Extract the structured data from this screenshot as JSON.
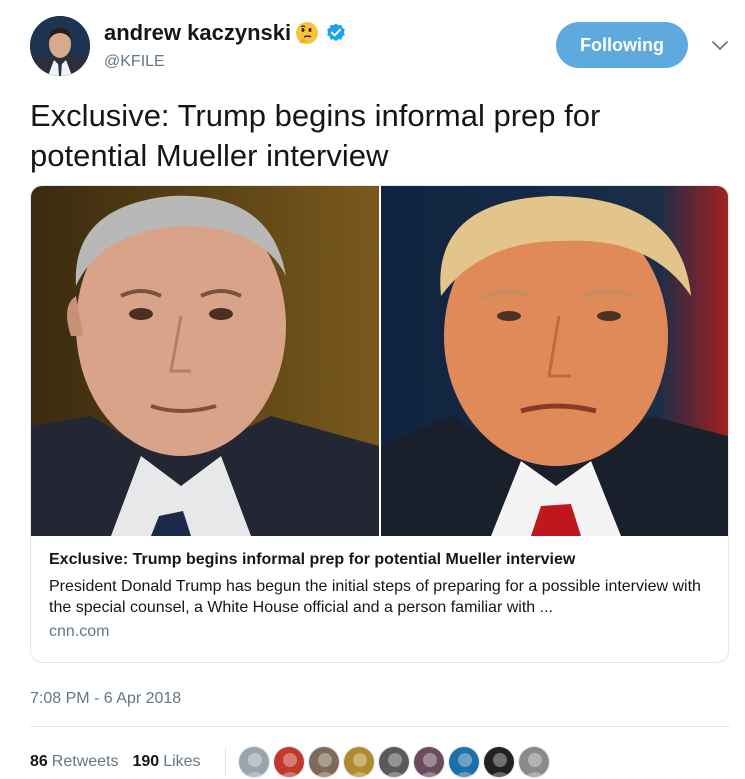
{
  "author": {
    "display_name": "andrew kaczynski",
    "handle": "@KFILE",
    "avatar_icon": "profile-photo",
    "name_emoji": "thinking-face-icon",
    "verified_icon": "verified-badge-icon"
  },
  "follow_button": {
    "label": "Following",
    "color": "#5ea9dd"
  },
  "menu_icon": "chevron-down-icon",
  "tweet": {
    "text": "Exclusive: Trump begins informal prep for potential Mueller interview",
    "timestamp": "7:08 PM - 6 Apr 2018"
  },
  "card": {
    "image": "split-photo-two-men",
    "title": "Exclusive: Trump begins informal prep for potential Mueller interview",
    "description": "President Donald Trump has begun the initial steps of preparing for a possible interview with the special counsel, a White House official and a person familiar with ...",
    "domain": "cnn.com"
  },
  "stats": {
    "retweets_count": "86",
    "retweets_label": "Retweets",
    "likes_count": "190",
    "likes_label": "Likes"
  },
  "likers": [
    {
      "name": "liker-avatar-1",
      "color": "#9aa4ad"
    },
    {
      "name": "liker-avatar-2",
      "color": "#c0392b"
    },
    {
      "name": "liker-avatar-3",
      "color": "#7d6a5a"
    },
    {
      "name": "liker-avatar-4",
      "color": "#b08a2e"
    },
    {
      "name": "liker-avatar-5",
      "color": "#5a5a5a"
    },
    {
      "name": "liker-avatar-6",
      "color": "#6b4c5e"
    },
    {
      "name": "liker-avatar-7",
      "color": "#1f6fa8"
    },
    {
      "name": "liker-avatar-8",
      "color": "#222222"
    },
    {
      "name": "liker-avatar-9",
      "color": "#8a8a8a"
    }
  ]
}
